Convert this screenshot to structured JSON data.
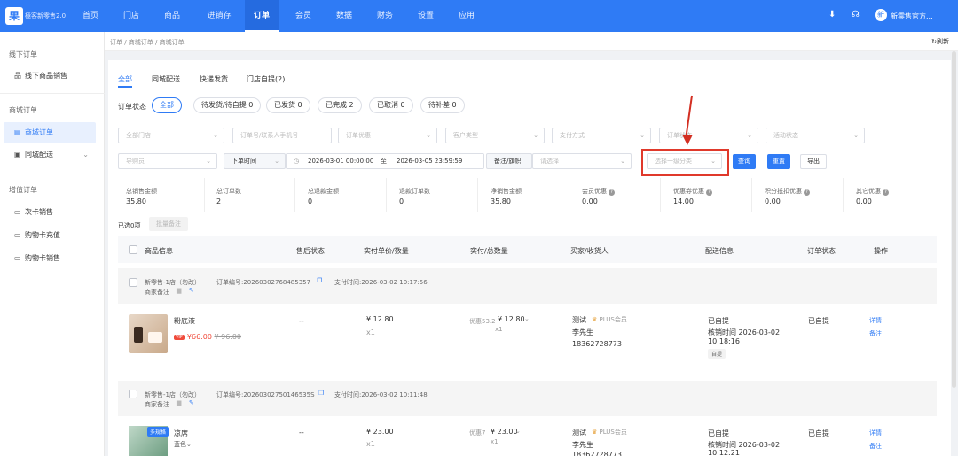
{
  "app": {
    "logo_char": "果",
    "logo_text": "極客新零售2.0",
    "user_avatar": "新",
    "user_name": "新零售官方..."
  },
  "nav": [
    {
      "label": "首页"
    },
    {
      "label": "门店"
    },
    {
      "label": "商品"
    },
    {
      "label": "进销存"
    },
    {
      "label": "订单"
    },
    {
      "label": "会员"
    },
    {
      "label": "数据"
    },
    {
      "label": "财务"
    },
    {
      "label": "设置"
    },
    {
      "label": "应用"
    }
  ],
  "top_icons": {
    "download": "⬇",
    "headset": "☊"
  },
  "sidebar": {
    "group1": "线下订单",
    "item1": "线下商品销售",
    "group2": "商城订单",
    "item2": "商城订单",
    "item3": "同城配送",
    "group3": "增值订单",
    "item4": "次卡销售",
    "item5": "购物卡充值",
    "item6": "购物卡销售"
  },
  "breadcrumb": "订单 / 商城订单 / 商城订单",
  "refresh": "刷新",
  "tabs": [
    "全部",
    "同城配送",
    "快递发货",
    "门店自提(2)"
  ],
  "status": {
    "label": "订单状态",
    "pills": [
      "全部",
      "待发货/待自提 0",
      "已发货 0",
      "已完成 2",
      "已取消 0",
      "待补差 0"
    ]
  },
  "filters": {
    "row1": [
      "全部门店",
      "订单号/联系人手机号",
      "订单优惠",
      "客户类型",
      "支付方式",
      "订单状态",
      "活动状态"
    ],
    "row2_guide": "导购员",
    "time_type": "下单时间",
    "date_start": "2026-03-01 00:00:00",
    "date_sep": "至",
    "date_end": "2026-03-05 23:59:59",
    "remark": "备注/旗帜",
    "remark_select": "请选择",
    "category": "选择一级分类",
    "search": "查询",
    "reset": "重置",
    "export": "导出"
  },
  "stats": [
    {
      "label": "总销售金额",
      "value": "35.80"
    },
    {
      "label": "总订单数",
      "value": "2"
    },
    {
      "label": "总退款金额",
      "value": "0"
    },
    {
      "label": "退款订单数",
      "value": "0"
    },
    {
      "label": "净销售金额",
      "value": "35.80"
    },
    {
      "label": "会员优惠",
      "value": "0.00"
    },
    {
      "label": "优惠券优惠",
      "value": "14.00"
    },
    {
      "label": "积分抵扣优惠",
      "value": "0.00"
    },
    {
      "label": "其它优惠",
      "value": "0.00"
    }
  ],
  "selected": "已选0项",
  "batch": "批量备注",
  "headers": [
    "商品信息",
    "售后状态",
    "实付单价/数量",
    "实付/总数量",
    "买家/收货人",
    "配送信息",
    "订单状态",
    "操作"
  ],
  "orders": [
    {
      "store": "新零售-1店（勿改）",
      "order_no": "订单编号:20260302768485357",
      "pay_time": "支付时间:2026-03-02 10:17:56",
      "merchant_note": "商家备注",
      "product": "粉底液",
      "price": "¥66.00",
      "orig_price": "¥ 96.00",
      "vip": "VIP",
      "after_sale": "--",
      "unit_price": "¥ 12.80",
      "qty": "x1",
      "discount": "优惠53.2",
      "paid_total": "¥ 12.80",
      "paid_qty": "x1",
      "buyer": "测试",
      "plus": "PLUS会员",
      "receiver": "李先生",
      "phone": "18362728773",
      "delivery": "已自提",
      "verify": "核销时间 2026-03-02",
      "verify_time": "10:18:16",
      "delivery_tag": "自提",
      "order_status": "已自提",
      "op1": "详情",
      "op2": "备注"
    },
    {
      "store": "新零售-1店（勿改）",
      "order_no": "订单编号:20260302750146535S",
      "pay_time": "支付时间:2026-03-02 10:11:48",
      "merchant_note": "商家备注",
      "product": "凉席",
      "spec": "蓝色",
      "multi": "多规格",
      "after_sale": "--",
      "unit_price": "¥ 23.00",
      "qty": "x1",
      "discount": "优惠7",
      "paid_total": "¥ 23.00",
      "paid_qty": "x1",
      "buyer": "测试",
      "plus": "PLUS会员",
      "receiver": "李先生",
      "phone": "18362728773",
      "delivery": "已自提",
      "verify": "核销时间 2026-03-02",
      "verify_time": "10:12:21",
      "order_status": "已自提",
      "op1": "详情",
      "op2": "备注"
    }
  ]
}
